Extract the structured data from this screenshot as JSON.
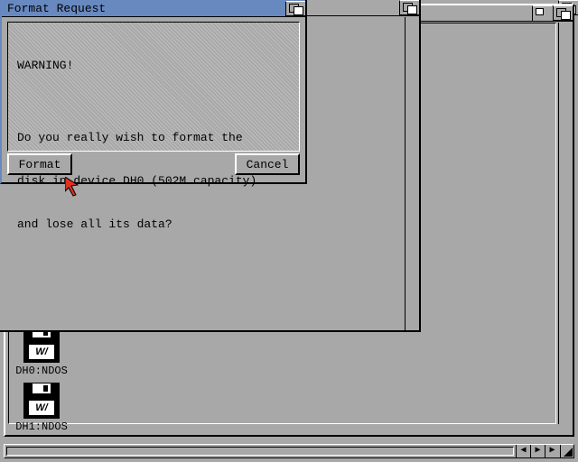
{
  "dialog": {
    "title": "Format Request",
    "warning_heading": "WARNING!",
    "message_line1": "Do you really wish to format the",
    "message_line2": "disk in device DH0 (502M capacity)",
    "message_line3": "and lose all its data?",
    "format_label": "Format",
    "cancel_label": "Cancel"
  },
  "disks": [
    {
      "label": "DH0:NDOS"
    },
    {
      "label": "DH1:NDOS"
    }
  ],
  "scroll_arrows": {
    "left": "◀",
    "right": "▶",
    "up_alt": "▶"
  }
}
